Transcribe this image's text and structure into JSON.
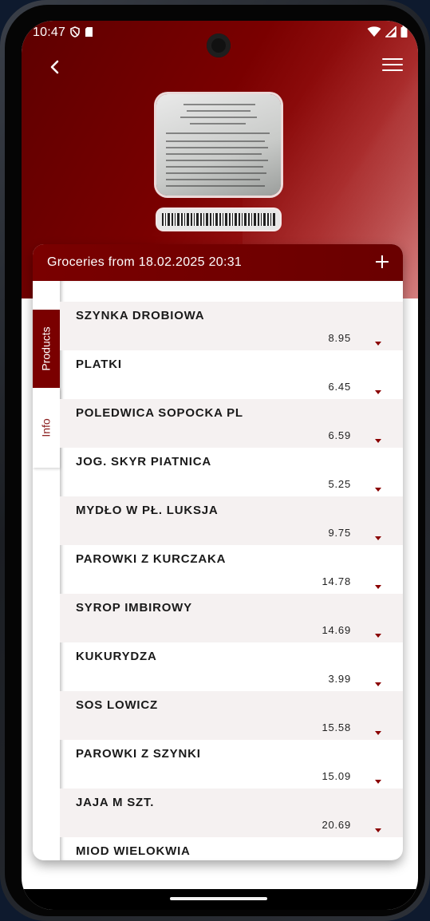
{
  "status_bar": {
    "time": "10:47"
  },
  "header": {
    "back_icon": "back-arrow-icon",
    "menu_icon": "hamburger-menu-icon"
  },
  "card": {
    "title": "Groceries from 18.02.2025 20:31",
    "add_icon": "plus-icon"
  },
  "tabs": [
    {
      "label": "Products",
      "selected": true
    },
    {
      "label": "Info",
      "selected": false
    }
  ],
  "items": [
    {
      "name": "SZYNKA DROBIOWA",
      "price": "8.95"
    },
    {
      "name": "PLATKI",
      "price": "6.45"
    },
    {
      "name": "POLEDWICA SOPOCKA PL",
      "price": "6.59"
    },
    {
      "name": "JOG. SKYR PIATNICA",
      "price": "5.25"
    },
    {
      "name": "MYDŁO W PŁ. LUKSJA",
      "price": "9.75"
    },
    {
      "name": "PAROWKI Z KURCZAKA",
      "price": "14.78"
    },
    {
      "name": "SYROP IMBIROWY",
      "price": "14.69"
    },
    {
      "name": "KUKURYDZA",
      "price": "3.99"
    },
    {
      "name": "SOS LOWICZ",
      "price": "15.58"
    },
    {
      "name": "PAROWKI Z SZYNKI",
      "price": "15.09"
    },
    {
      "name": "JAJA M SZT.",
      "price": "20.69"
    },
    {
      "name": "MIOD WIELOKWIA",
      "price": ""
    }
  ],
  "colors": {
    "brand": "#7a0000",
    "row_alt": "#f5f1f1",
    "caret": "#8a0000"
  }
}
